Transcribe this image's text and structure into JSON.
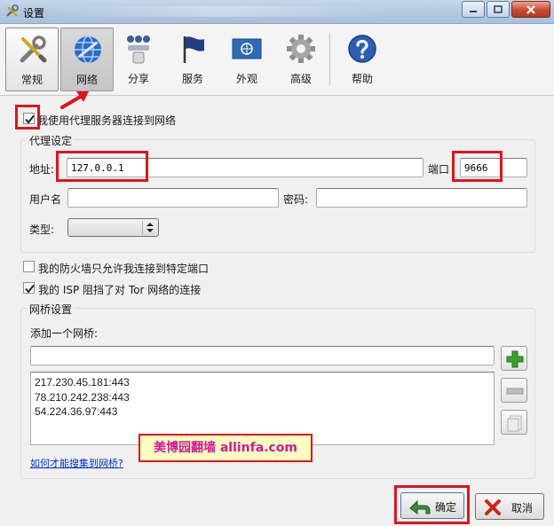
{
  "window": {
    "title": "设置",
    "icon": "wrench-screwdriver-icon",
    "controls": [
      "minimize-icon",
      "maximize-icon",
      "close-icon"
    ]
  },
  "toolbar": {
    "items": [
      {
        "label": "常规",
        "icon": "wrench-screwdriver-icon"
      },
      {
        "label": "网络",
        "icon": "globe-icon"
      },
      {
        "label": "分享",
        "icon": "network-share-icon"
      },
      {
        "label": "服务",
        "icon": "flag-icon"
      },
      {
        "label": "外观",
        "icon": "un-flag-icon"
      },
      {
        "label": "高级",
        "icon": "gear-icon"
      },
      {
        "label": "帮助",
        "icon": "help-icon"
      }
    ],
    "active_index": 1
  },
  "proxy": {
    "use_proxy_label": "我使用代理服务器连接到网络",
    "use_proxy_checked": true,
    "group_title": "代理设定",
    "address_label": "地址:",
    "address_value": "127.0.0.1",
    "port_label": "端口",
    "port_value": "9666",
    "username_label": "用户名",
    "username_value": "",
    "password_label": "密码:",
    "password_value": "",
    "type_label": "类型:",
    "type_value": ""
  },
  "firewall": {
    "label": "我的防火墙只允许我连接到特定端口",
    "checked": false
  },
  "isp": {
    "label": "我的 ISP 阻挡了对 Tor 网络的连接",
    "checked": true
  },
  "bridges": {
    "group_title": "网桥设置",
    "add_label": "添加一个网桥:",
    "input_value": "",
    "list": [
      "217.230.45.181:443",
      "78.210.242.238:443",
      "54.224.36.97:443"
    ],
    "help_link": "如何才能搜集到网桥?"
  },
  "watermark": "美博园翻墙 allinfa.com",
  "buttons": {
    "ok": "确定",
    "cancel": "取消"
  },
  "colors": {
    "highlight_red": "#e0141b",
    "link_blue": "#0033cc",
    "watermark_text": "#d0199a",
    "watermark_bg": "#fffec0",
    "add_green": "#3aa12a"
  }
}
